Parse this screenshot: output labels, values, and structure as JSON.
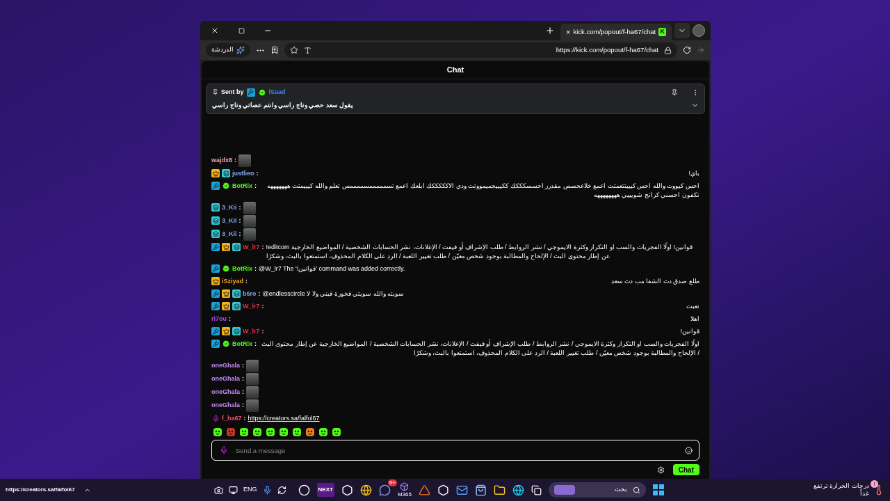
{
  "browser": {
    "tab": {
      "close": "×",
      "title": "kick.com/popout/f-ha67/chat",
      "logo": "K"
    },
    "copilot_label": "الدردشة",
    "url": "https://kick.com/popout/f-ha67/chat"
  },
  "chat": {
    "title": "Chat",
    "separator": ":",
    "pinned": {
      "label": "Sent by",
      "badges": [
        {
          "kind": "moderator"
        },
        {
          "kind": "verified"
        }
      ],
      "username": "iSaad",
      "color": "#3b82f6",
      "text": "يقول سعد حصي وتاج راسي وانتم عصاتي وتاج راسي"
    },
    "messages": [
      {
        "kind": "emote",
        "username": "wajdx8",
        "color": "#e9a3b5"
      },
      {
        "kind": "text",
        "username": "justlieo",
        "color": "#86a9ee",
        "badges": [
          {
            "kind": "crown"
          },
          {
            "kind": "subscriber"
          }
        ],
        "text": "باي!"
      },
      {
        "kind": "text",
        "username": "BotRix",
        "color": "#53fc18",
        "badges": [
          {
            "kind": "moderator"
          },
          {
            "kind": "verified"
          }
        ],
        "text": "احس كيووت والله احس كيييتتعمتت اعمع خلاعحصص مقدرر احسسكككك ككيييجميمووتت ودي الاكككككك ابلعك اعمع تسمممممسممممس تعلم والله كيييمتت هههههههه تكفون احسني كراتج شويييي ههههههههه"
      },
      {
        "kind": "emote",
        "username": "3_Kii",
        "color": "#86a9ee",
        "badges": [
          {
            "kind": "subscriber"
          }
        ]
      },
      {
        "kind": "emote",
        "username": "3_Kii",
        "color": "#86a9ee",
        "badges": [
          {
            "kind": "subscriber"
          }
        ]
      },
      {
        "kind": "emote",
        "username": "3_Kii",
        "color": "#86a9ee",
        "badges": [
          {
            "kind": "subscriber"
          }
        ]
      },
      {
        "kind": "text",
        "username": "W_lr7",
        "color": "#e5323f",
        "badges": [
          {
            "kind": "moderator"
          },
          {
            "kind": "crown"
          },
          {
            "kind": "subscriber"
          }
        ],
        "text": "!editcom قوانين! اولًا الفجريات والسب او التكرار وكثرة الايموجي / نشر الروابط / طلب الإشراف أو فيفت / الإعلانات، نشر الحسابات الشخصية / المواضيع الخارجية عن إطار محتوى البث / الإلحاح والمطالبة بوجود شخص معيّن / طلب تغيير اللعبة / الرد على الكلام المحذوف، استمتعوا بالبث، وشكرًا"
      },
      {
        "kind": "text",
        "username": "BotRix",
        "color": "#53fc18",
        "badges": [
          {
            "kind": "moderator"
          },
          {
            "kind": "verified"
          }
        ],
        "text": "@W_lr7 The '!قوانين' command was added correctly."
      },
      {
        "kind": "text",
        "username": "iSziyad",
        "color": "#f5a623",
        "badges": [
          {
            "kind": "crown"
          }
        ],
        "text": "طلع صدق دث الشفا مب دث سعد"
      },
      {
        "kind": "text",
        "username": "b6ro",
        "color": "#8b9cf4",
        "badges": [
          {
            "kind": "moderator"
          },
          {
            "kind": "crown"
          },
          {
            "kind": "subscriber"
          }
        ],
        "text": "@endlesscircle سويته والله سويتي فخورة فيني ولا لا"
      },
      {
        "kind": "text",
        "username": "W_lr7",
        "color": "#e5323f",
        "badges": [
          {
            "kind": "moderator"
          },
          {
            "kind": "crown"
          },
          {
            "kind": "subscriber"
          }
        ],
        "text": "تعبت"
      },
      {
        "kind": "text",
        "username": "ri7ou",
        "color": "#a855f7",
        "text": "اهلا"
      },
      {
        "kind": "text",
        "username": "W_lr7",
        "color": "#e5323f",
        "badges": [
          {
            "kind": "moderator"
          },
          {
            "kind": "crown"
          },
          {
            "kind": "subscriber"
          }
        ],
        "text": "قوانين!"
      },
      {
        "kind": "text",
        "username": "BotRix",
        "color": "#53fc18",
        "badges": [
          {
            "kind": "moderator"
          },
          {
            "kind": "verified"
          }
        ],
        "text": "اولًا الفجريات والسب او التكرار وكثرة الايموجي / نشر الروابط / طلب الإشراف أو فيفت / الإعلانات، نشر الحسابات الشخصية / المواضيع الخارجية عن إطار محتوى البث / الإلحاح والمطالبة بوجود شخص معيّن / طلب تغيير اللعبة / الرد على الكلام المحذوف، استمتعوا بالبث، وشكرًا"
      },
      {
        "kind": "emote",
        "username": "oneGhala",
        "color": "#c58af9"
      },
      {
        "kind": "emote",
        "username": "oneGhala",
        "color": "#c58af9"
      },
      {
        "kind": "emote",
        "username": "oneGhala",
        "color": "#c58af9"
      },
      {
        "kind": "emote",
        "username": "oneGhala",
        "color": "#c58af9"
      },
      {
        "kind": "link",
        "username": "f_ha67",
        "color": "#f0506e",
        "badges": [
          {
            "kind": "mic"
          }
        ],
        "text": "https://creators.sa/falfol67"
      }
    ],
    "composer": {
      "placeholder": "Send a message",
      "button": "Chat"
    }
  },
  "taskbar": {
    "overlay_text": "https://creators.sa/falfol67",
    "language": "ENG",
    "next_label": "NEXT",
    "discord_badge": "9+",
    "m365_label": "M365",
    "search_placeholder": "بحث",
    "weather": {
      "line_1": "درجات الحرارة ترتفع",
      "line_2": "غداً",
      "alert": "!"
    }
  }
}
